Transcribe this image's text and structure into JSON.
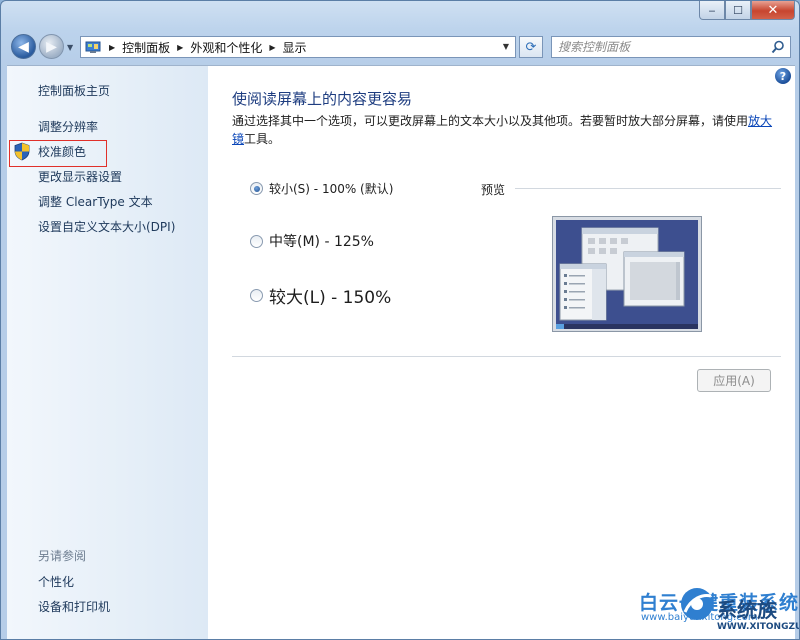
{
  "window": {
    "minimize_label": "‒",
    "maximize_label": "☐",
    "close_label": "✕"
  },
  "navigation": {
    "breadcrumbs": [
      "控制面板",
      "外观和个性化",
      "显示"
    ],
    "search_placeholder": "搜索控制面板"
  },
  "sidebar": {
    "home": "控制面板主页",
    "items": [
      "调整分辨率",
      "校准颜色",
      "更改显示器设置",
      "调整 ClearType 文本",
      "设置自定义文本大小(DPI)"
    ],
    "see_also_label": "另请参阅",
    "see_also": [
      "个性化",
      "设备和打印机"
    ]
  },
  "main": {
    "help_label": "?",
    "title": "使阅读屏幕上的内容更容易",
    "desc_before_link": "通过选择其中一个选项，可以更改屏幕上的文本大小以及其他项。若要暂时放大部分屏幕，请使用",
    "desc_link": "放大镜",
    "desc_after_link": "工具。",
    "options": [
      {
        "label": "较小(S) - 100% (默认)",
        "selected": true
      },
      {
        "label": "中等(M) - 125%",
        "selected": false
      },
      {
        "label": "较大(L) - 150%",
        "selected": false
      }
    ],
    "preview_label": "预览",
    "apply_label": "应用(A)"
  },
  "watermark": {
    "text": "白云一键重装系统",
    "text_url": "www.baiyunxitong.com",
    "brand": "系统族",
    "brand_url": "WWW.XITONGZU.COM"
  },
  "colors": {
    "link": "#1e395b",
    "title": "#1e3d80",
    "accent": "#0a46b8",
    "highlight_box": "#e0302a"
  }
}
